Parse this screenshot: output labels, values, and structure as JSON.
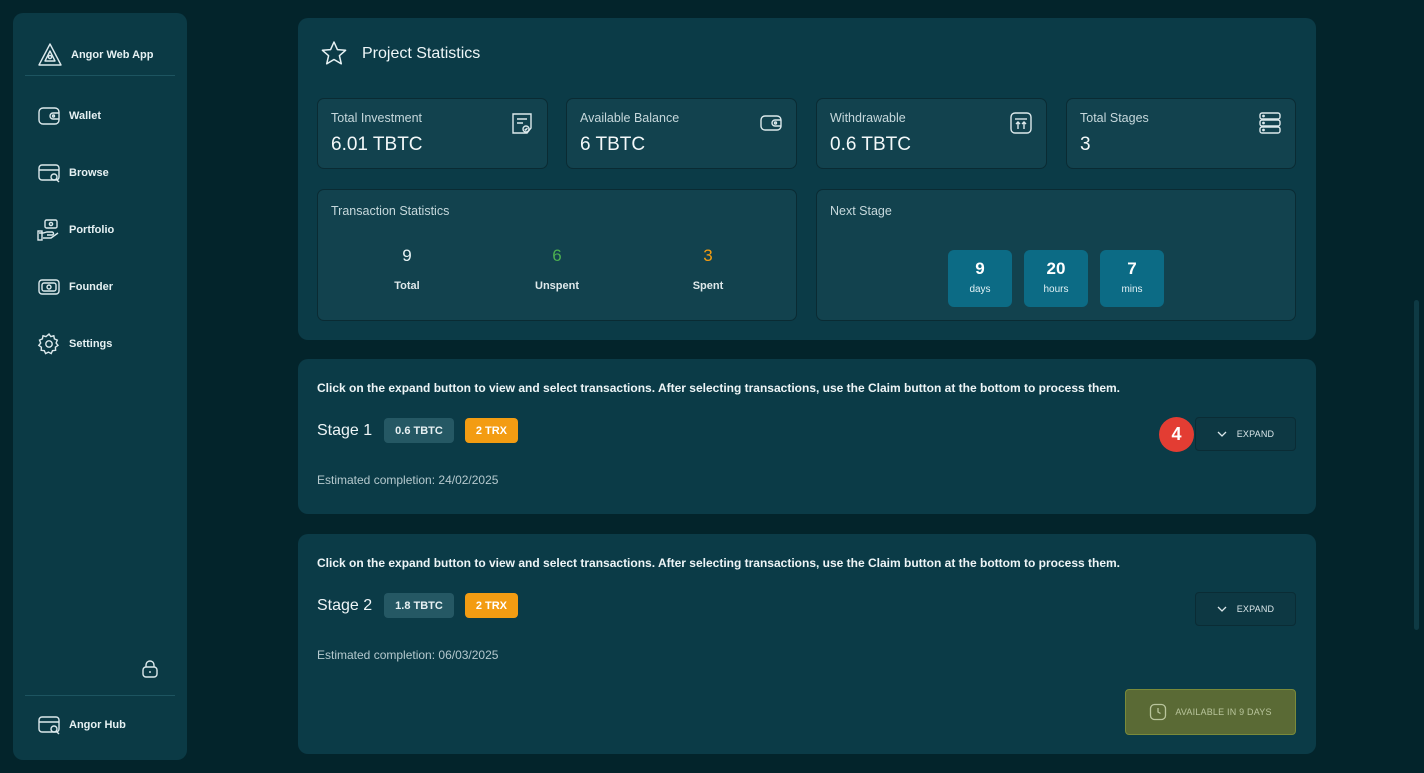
{
  "brand": {
    "name": "Angor Web App"
  },
  "nav": {
    "items": [
      {
        "label": "Wallet",
        "icon": "wallet-icon"
      },
      {
        "label": "Browse",
        "icon": "browse-icon"
      },
      {
        "label": "Portfolio",
        "icon": "portfolio-icon"
      },
      {
        "label": "Founder",
        "icon": "founder-icon"
      },
      {
        "label": "Settings",
        "icon": "gear-icon"
      }
    ],
    "hub_label": "Angor Hub"
  },
  "stats": {
    "title": "Project Statistics",
    "tiles": [
      {
        "label": "Total Investment",
        "value": "6.01 TBTC",
        "icon": "receipt-icon"
      },
      {
        "label": "Available Balance",
        "value": "6 TBTC",
        "icon": "wallet-icon"
      },
      {
        "label": "Withdrawable",
        "value": "0.6 TBTC",
        "icon": "withdraw-icon"
      },
      {
        "label": "Total Stages",
        "value": "3",
        "icon": "stack-icon"
      }
    ],
    "transactions": {
      "label": "Transaction Statistics",
      "total": {
        "value": "9",
        "label": "Total"
      },
      "unspent": {
        "value": "6",
        "label": "Unspent"
      },
      "spent": {
        "value": "3",
        "label": "Spent"
      }
    },
    "next_stage": {
      "label": "Next Stage",
      "days": {
        "value": "9",
        "unit": "days"
      },
      "hours": {
        "value": "20",
        "unit": "hours"
      },
      "mins": {
        "value": "7",
        "unit": "mins"
      }
    }
  },
  "stages": [
    {
      "info": "Click on the expand button to view and select transactions. After selecting transactions, use the Claim button at the bottom to process them.",
      "name": "Stage 1",
      "amount": "0.6 TBTC",
      "trx": "2 TRX",
      "estimated": "Estimated completion: 24/02/2025",
      "expand_label": "EXPAND",
      "step_badge": "4"
    },
    {
      "info": "Click on the expand button to view and select transactions. After selecting transactions, use the Claim button at the bottom to process them.",
      "name": "Stage 2",
      "amount": "1.8 TBTC",
      "trx": "2 TRX",
      "estimated": "Estimated completion: 06/03/2025",
      "expand_label": "EXPAND",
      "available_label": "AVAILABLE IN 9 DAYS"
    }
  ],
  "colors": {
    "background": "#03242b",
    "card": "#0b3b47",
    "accent": "#0c6b85",
    "unspent": "#4caf50",
    "spent": "#f39c12",
    "badge": "#e33d33"
  }
}
